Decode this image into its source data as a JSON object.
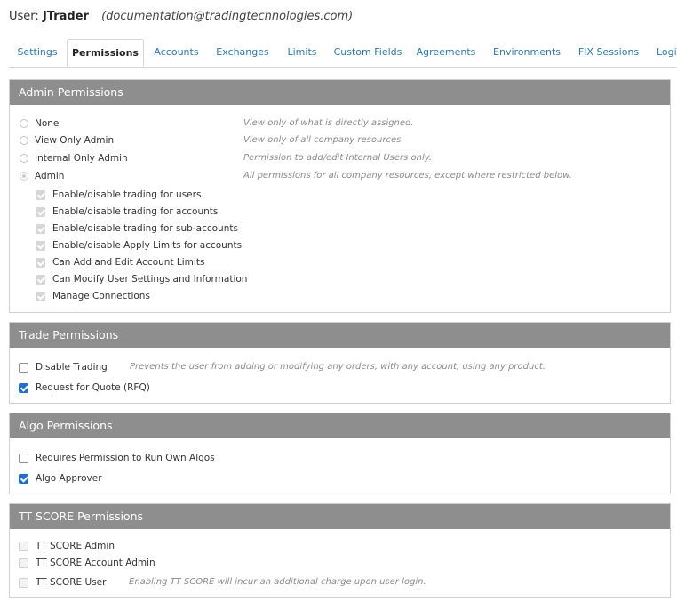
{
  "header": {
    "user_label": "User:",
    "user_name": "JTrader",
    "user_email": "(documentation@tradingtechnologies.com)"
  },
  "tabs": [
    {
      "label": "Settings",
      "active": false
    },
    {
      "label": "Permissions",
      "active": true
    },
    {
      "label": "Accounts",
      "active": false
    },
    {
      "label": "Exchanges",
      "active": false
    },
    {
      "label": "Limits",
      "active": false
    },
    {
      "label": "Custom Fields",
      "active": false
    },
    {
      "label": "Agreements",
      "active": false
    },
    {
      "label": "Environments",
      "active": false
    },
    {
      "label": "FIX Sessions",
      "active": false
    },
    {
      "label": "Logi",
      "active": false
    }
  ],
  "admin": {
    "title": "Admin Permissions",
    "options": [
      {
        "label": "None",
        "desc": "View only of what is directly assigned.",
        "selected": false
      },
      {
        "label": "View Only Admin",
        "desc": "View only of all company resources.",
        "selected": false
      },
      {
        "label": "Internal Only Admin",
        "desc": "Permission to add/edit Internal Users only.",
        "selected": false
      },
      {
        "label": "Admin",
        "desc": "All permissions for all company resources, except where restricted below.",
        "selected": true
      }
    ],
    "sub_permissions": [
      "Enable/disable trading for users",
      "Enable/disable trading for accounts",
      "Enable/disable trading for sub-accounts",
      "Enable/disable Apply Limits for accounts",
      "Can Add and Edit Account Limits",
      "Can Modify User Settings and Information",
      "Manage Connections"
    ]
  },
  "trade": {
    "title": "Trade Permissions",
    "disable_trading": {
      "label": "Disable Trading",
      "desc": "Prevents the user from adding or modifying any orders, with any account, using any product.",
      "checked": false
    },
    "rfq": {
      "label": "Request for Quote (RFQ)",
      "checked": true
    }
  },
  "algo": {
    "title": "Algo Permissions",
    "requires_permission": {
      "label": "Requires Permission to Run Own Algos",
      "checked": false
    },
    "approver": {
      "label": "Algo Approver",
      "checked": true
    }
  },
  "score": {
    "title": "TT SCORE Permissions",
    "admin": {
      "label": "TT SCORE Admin",
      "checked": false
    },
    "account_admin": {
      "label": "TT SCORE Account Admin",
      "checked": false
    },
    "user": {
      "label": "TT SCORE User",
      "desc": "Enabling TT SCORE will incur an additional charge upon user login.",
      "checked": false
    }
  }
}
